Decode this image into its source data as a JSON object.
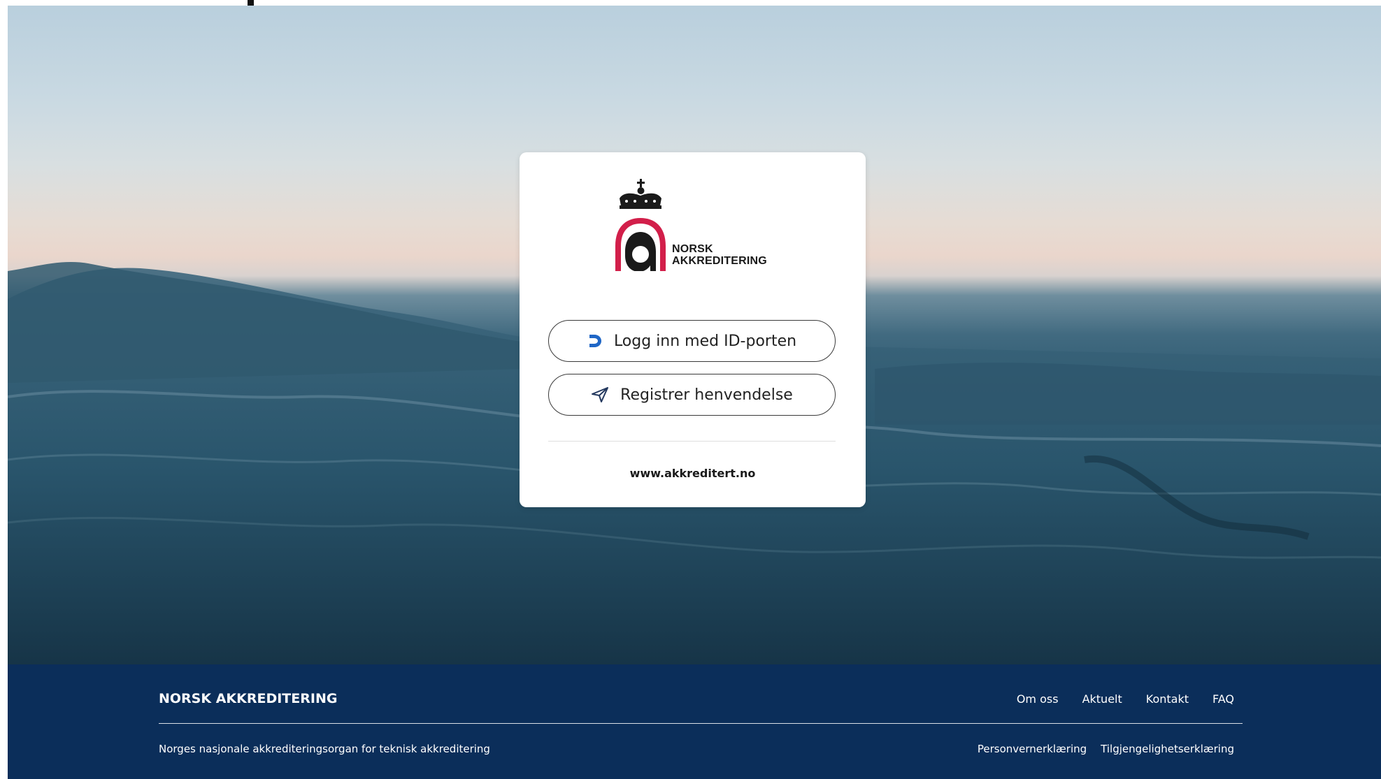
{
  "logo": {
    "line1": "NORSK",
    "line2": "AKKREDITERING",
    "accent_color": "#d21f4a",
    "crown_icon": "crown-icon"
  },
  "login_card": {
    "idporten_button": {
      "label": "Logg inn med ID-porten",
      "icon": "idporten-icon",
      "icon_color": "#1f66c6"
    },
    "register_button": {
      "label": "Registrer henvendelse",
      "icon": "send-icon",
      "icon_color": "#23385e"
    },
    "website_link": "www.akkreditert.no"
  },
  "footer": {
    "brand": "NORSK AKKREDITERING",
    "nav": [
      "Om oss",
      "Aktuelt",
      "Kontakt",
      "FAQ"
    ],
    "tagline": "Norges nasjonale akkrediteringsorgan for teknisk akkreditering",
    "legal_links": [
      "Personvernerklæring",
      "Tilgjengelighetserklæring"
    ],
    "background_color": "#0b2e5a"
  }
}
